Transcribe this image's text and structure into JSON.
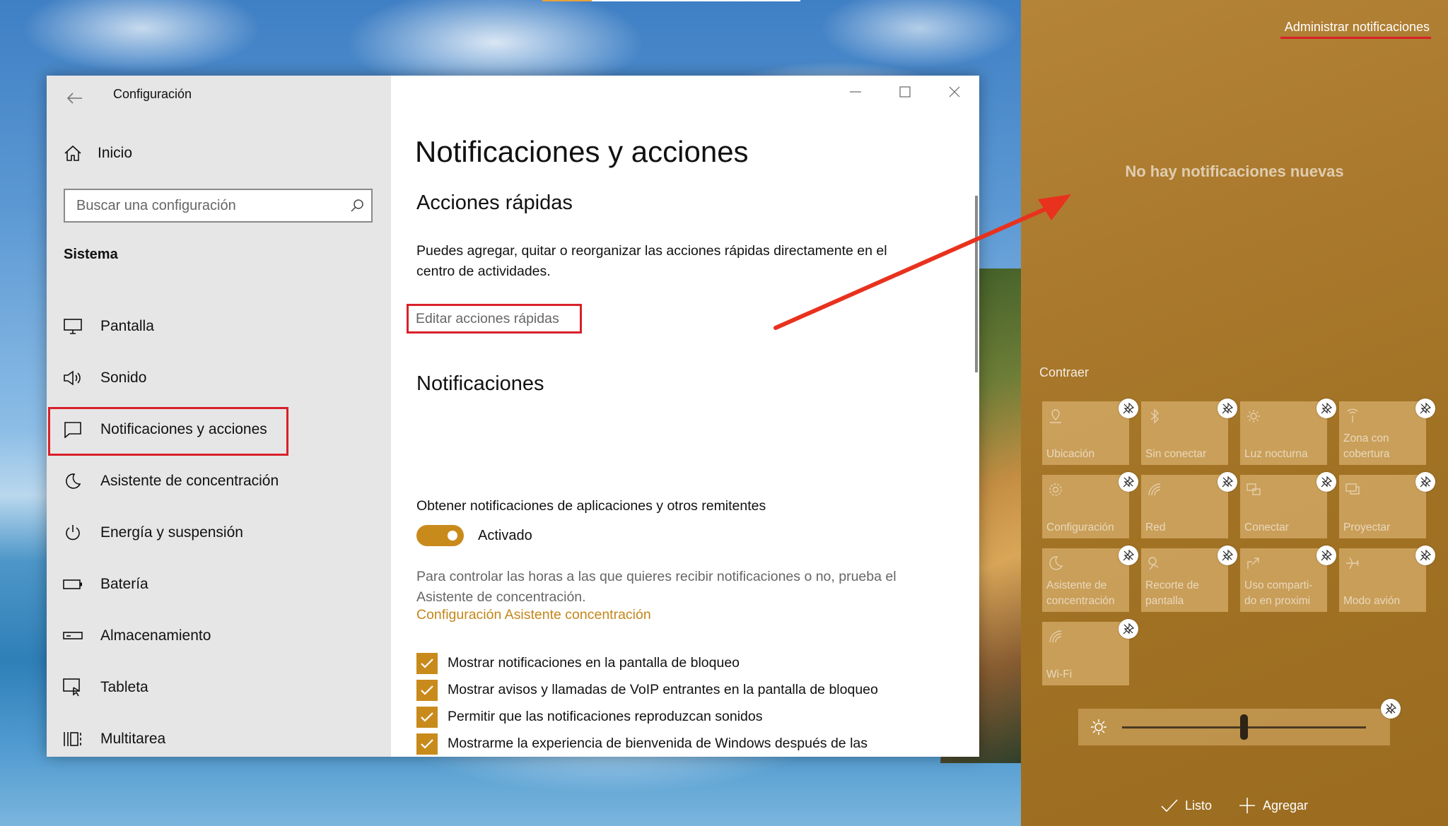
{
  "settings": {
    "window_title": "Configuración",
    "home_label": "Inicio",
    "search_placeholder": "Buscar una configuración",
    "section_label": "Sistema",
    "nav_items": [
      {
        "label": "Pantalla",
        "icon": "monitor-icon"
      },
      {
        "label": "Sonido",
        "icon": "speaker-icon"
      },
      {
        "label": "Notificaciones y acciones",
        "icon": "notification-icon",
        "selected": true
      },
      {
        "label": "Asistente de concentración",
        "icon": "moon-icon"
      },
      {
        "label": "Energía y suspensión",
        "icon": "power-icon"
      },
      {
        "label": "Batería",
        "icon": "battery-icon"
      },
      {
        "label": "Almacenamiento",
        "icon": "storage-icon"
      },
      {
        "label": "Tableta",
        "icon": "tablet-icon"
      },
      {
        "label": "Multitarea",
        "icon": "multitask-icon"
      }
    ],
    "page_title": "Notificaciones y acciones",
    "quick_actions_heading": "Acciones rápidas",
    "quick_actions_text": "Puedes agregar, quitar o reorganizar las acciones rápidas directamente en el centro de actividades.",
    "edit_quick_actions": "Editar acciones rápidas",
    "notifications_heading": "Notificaciones",
    "get_notifications_label": "Obtener notificaciones de aplicaciones y otros remitentes",
    "toggle_state": "Activado",
    "focus_hint": "Para controlar las horas a las que quieres recibir notificaciones o no, prueba el Asistente de concentración.",
    "focus_link": "Configuración Asistente concentración",
    "checkboxes": [
      {
        "label": "Mostrar notificaciones en la pantalla de bloqueo",
        "checked": true
      },
      {
        "label": "Mostrar avisos y llamadas de VoIP entrantes en la pantalla de bloqueo",
        "checked": true
      },
      {
        "label": "Permitir que las notificaciones reproduzcan sonidos",
        "checked": true
      },
      {
        "label": "Mostrarme la experiencia de bienvenida de Windows después de las actualizaciones y cuando inicie sesión para conocer las novedades y sugerencias",
        "checked": true
      }
    ]
  },
  "action_center": {
    "manage_link": "Administrar notificaciones",
    "no_notifications": "No hay notificaciones nuevas",
    "collapse": "Contraer",
    "tiles": [
      {
        "label": "Ubicación",
        "icon": "location-icon"
      },
      {
        "label": "Sin conectar",
        "icon": "bluetooth-icon"
      },
      {
        "label": "Luz nocturna",
        "icon": "brightness-icon"
      },
      {
        "label": "Zona con cobertura",
        "icon": "hotspot-icon"
      },
      {
        "label": "Configuración",
        "icon": "gear-icon"
      },
      {
        "label": "Red",
        "icon": "network-icon"
      },
      {
        "label": "Conectar",
        "icon": "connect-icon"
      },
      {
        "label": "Proyectar",
        "icon": "project-icon"
      },
      {
        "label": "Asistente de concentración",
        "icon": "moon-icon"
      },
      {
        "label": "Recorte de pantalla",
        "icon": "snip-icon"
      },
      {
        "label": "Uso comparti- do en proximi",
        "icon": "share-icon"
      },
      {
        "label": "Modo avión",
        "icon": "airplane-icon"
      },
      {
        "label": "Wi-Fi",
        "icon": "wifi-icon"
      }
    ],
    "brightness_level": 0.5,
    "done_label": "Listo",
    "add_label": "Agregar"
  },
  "colors": {
    "accent": "#c98a1c",
    "annotation_red": "#d9202a",
    "action_center_bg": "#a9782c"
  }
}
